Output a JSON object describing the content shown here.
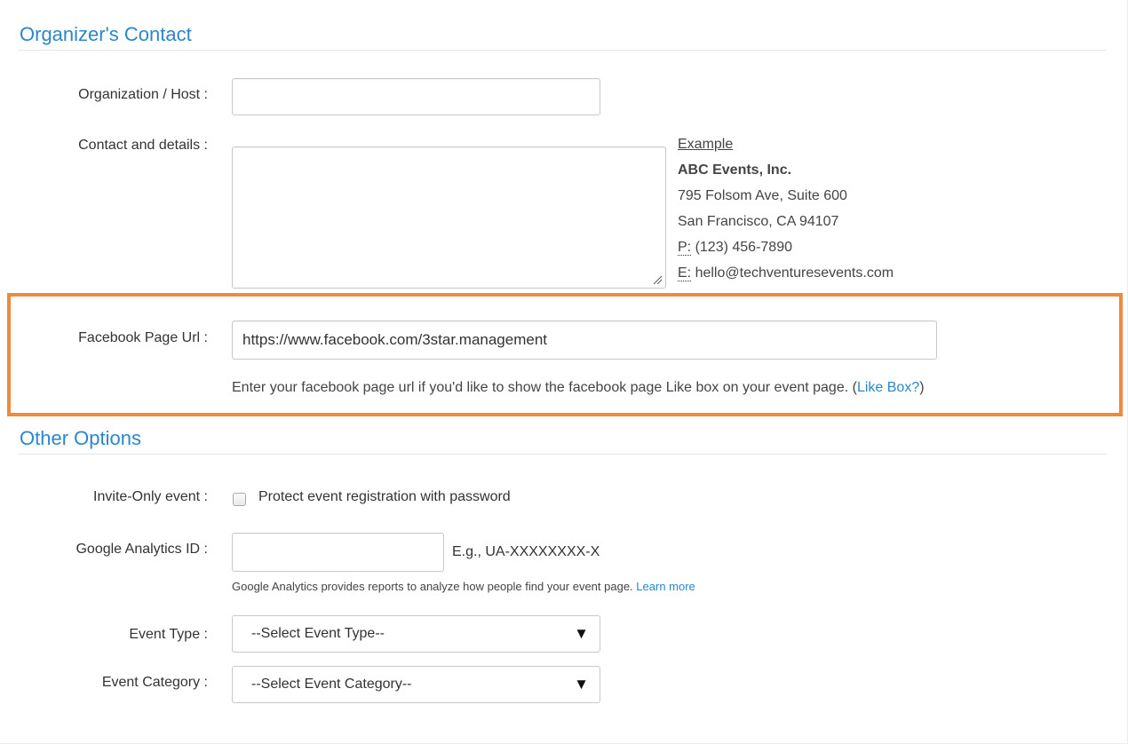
{
  "organizer": {
    "title": "Organizer's Contact",
    "org_label": "Organization / Host :",
    "org_value": "",
    "contact_label": "Contact and details :",
    "contact_value": "",
    "example": {
      "heading": "Example",
      "company": "ABC Events, Inc.",
      "address1": "795 Folsom Ave, Suite 600",
      "address2": "San Francisco, CA 94107",
      "phone_prefix": "P:",
      "phone": " (123) 456-7890",
      "email_prefix": "E:",
      "email": " hello@techventuresevents.com"
    },
    "facebook_label": "Facebook Page Url :",
    "facebook_value": "https://www.facebook.com/3star.management",
    "facebook_help": "Enter your facebook page url if you'd like to show the facebook page Like box on your event page. (",
    "facebook_help_link": "Like Box?",
    "facebook_help_end": ")",
    "highlight_color": "#ee8a3e"
  },
  "other": {
    "title": "Other Options",
    "invite_label": "Invite-Only event :",
    "invite_checkbox_label": "Protect event registration with password",
    "invite_checked": false,
    "ga_label": "Google Analytics ID :",
    "ga_value": "",
    "ga_example": "E.g., UA-XXXXXXXX-X",
    "ga_help": "Google Analytics provides reports to analyze how people find your event page.",
    "ga_learn_more": "Learn more",
    "event_type_label": "Event Type :",
    "event_type_selected": "--Select Event Type--",
    "event_category_label": "Event Category :",
    "event_category_selected": "--Select Event Category--",
    "caret_icon": "▼"
  },
  "colors": {
    "accent": "#2a87cf",
    "highlight": "#ee8a3e"
  }
}
